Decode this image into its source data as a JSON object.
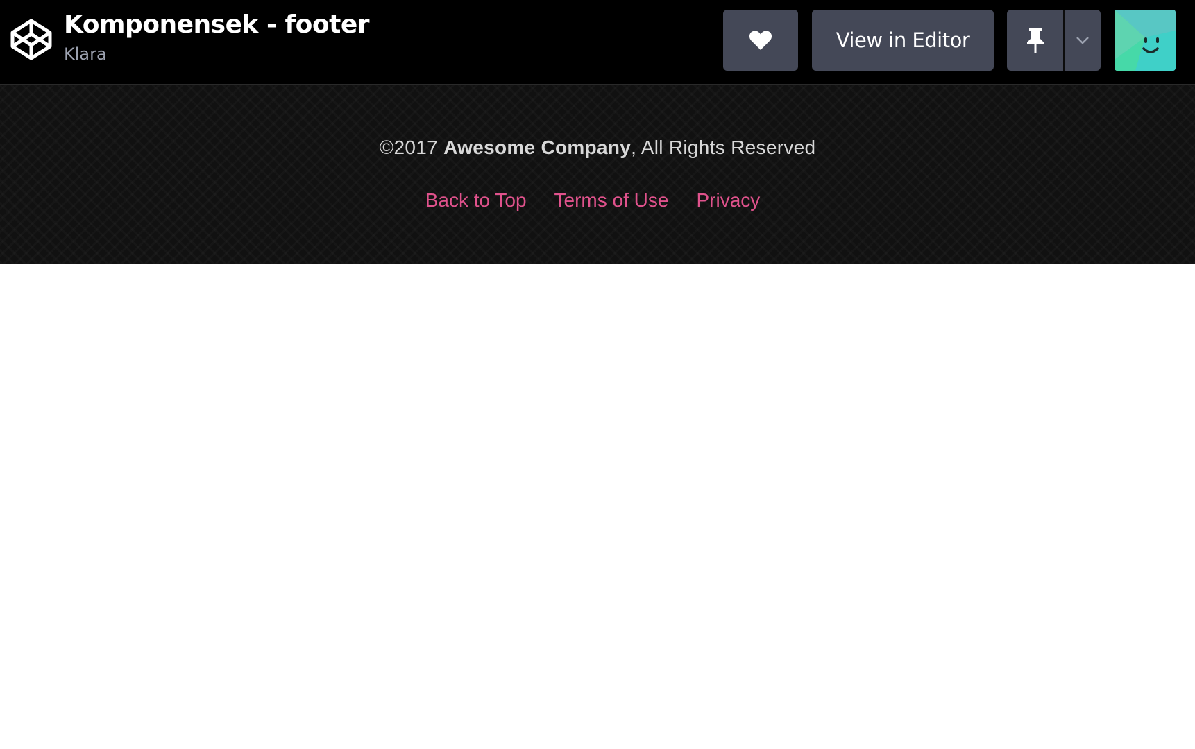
{
  "header": {
    "logo_icon": "codepen-logo-icon",
    "title": "Komponensek - footer",
    "author": "Klara",
    "heart_icon": "heart-icon",
    "view_in_editor_label": "View in Editor",
    "pin_icon": "pin-icon",
    "caret_icon": "chevron-down-icon",
    "avatar": "user-avatar"
  },
  "footer": {
    "copyright_prefix": "©2017 ",
    "company": "Awesome Company",
    "copyright_suffix": ", All Rights Reserved",
    "links": [
      {
        "label": "Back to Top"
      },
      {
        "label": "Terms of Use"
      },
      {
        "label": "Privacy"
      }
    ]
  },
  "colors": {
    "topbar_bg": "#000000",
    "button_bg": "#444857",
    "footer_bg": "#111111",
    "link_color": "#e0528c",
    "author_color": "#9da2b0"
  }
}
